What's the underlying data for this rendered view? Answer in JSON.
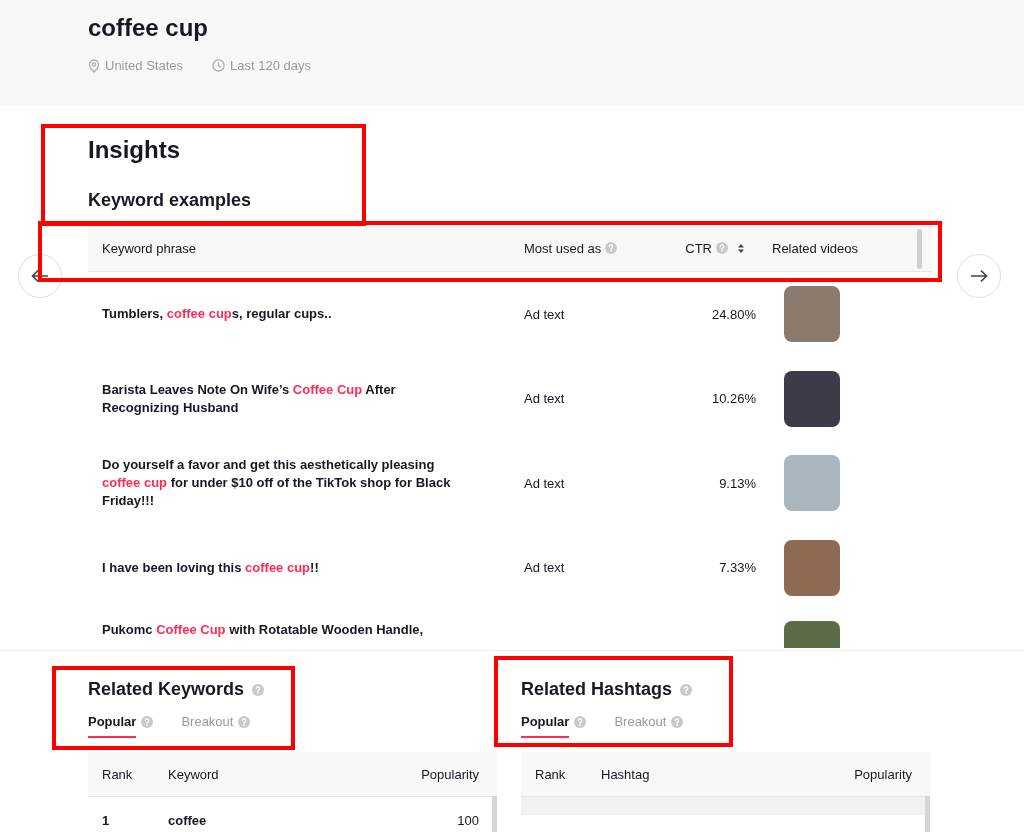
{
  "header": {
    "title": "coffee cup",
    "region": "United States",
    "period": "Last 120 days"
  },
  "insights": {
    "title": "Insights",
    "subtitle": "Keyword examples",
    "columns": [
      {
        "label": "Keyword phrase",
        "help": false,
        "sortable": false
      },
      {
        "label": "Most used as",
        "help": true,
        "sortable": false
      },
      {
        "label": "CTR",
        "help": true,
        "sortable": true
      },
      {
        "label": "Related videos",
        "help": false,
        "sortable": false
      }
    ],
    "rows": [
      {
        "phrase": [
          {
            "text": "Tumblers, ",
            "highlight": false
          },
          {
            "text": "coffee cup",
            "highlight": true
          },
          {
            "text": "s, regular cups..",
            "highlight": false
          }
        ],
        "used_as": "Ad text",
        "ctr": "24.80%"
      },
      {
        "phrase": [
          {
            "text": "Barista Leaves Note On Wife’s ",
            "highlight": false
          },
          {
            "text": "Coffee Cup",
            "highlight": true
          },
          {
            "text": " After Recognizing Husband",
            "highlight": false
          }
        ],
        "used_as": "Ad text",
        "ctr": "10.26%"
      },
      {
        "phrase": [
          {
            "text": "Do yourself a favor and get this aesthetically pleasing ",
            "highlight": false
          },
          {
            "text": "coffee cup",
            "highlight": true
          },
          {
            "text": " for under $10 off of the TikTok shop for Black Friday!!!",
            "highlight": false
          }
        ],
        "used_as": "Ad text",
        "ctr": "9.13%"
      },
      {
        "phrase": [
          {
            "text": "I have been loving this ",
            "highlight": false
          },
          {
            "text": "coffee cup",
            "highlight": true
          },
          {
            "text": "!!",
            "highlight": false
          }
        ],
        "used_as": "Ad text",
        "ctr": "7.33%"
      },
      {
        "phrase": [
          {
            "text": "Pukomc ",
            "highlight": false
          },
          {
            "text": "Coffee Cup",
            "highlight": true
          },
          {
            "text": " with Rotatable Wooden Handle,",
            "highlight": false
          }
        ]
      }
    ]
  },
  "related_keywords": {
    "title": "Related Keywords",
    "tabs": [
      {
        "label": "Popular",
        "selected": true
      },
      {
        "label": "Breakout",
        "selected": false
      }
    ],
    "columns": [
      "Rank",
      "Keyword",
      "Popularity"
    ],
    "rows": [
      {
        "rank": "1",
        "keyword": "coffee",
        "popularity": "100"
      }
    ]
  },
  "related_hashtags": {
    "title": "Related Hashtags",
    "tabs": [
      {
        "label": "Popular",
        "selected": true
      },
      {
        "label": "Breakout",
        "selected": false
      }
    ],
    "columns": [
      "Rank",
      "Hashtag",
      "Popularity"
    ]
  }
}
